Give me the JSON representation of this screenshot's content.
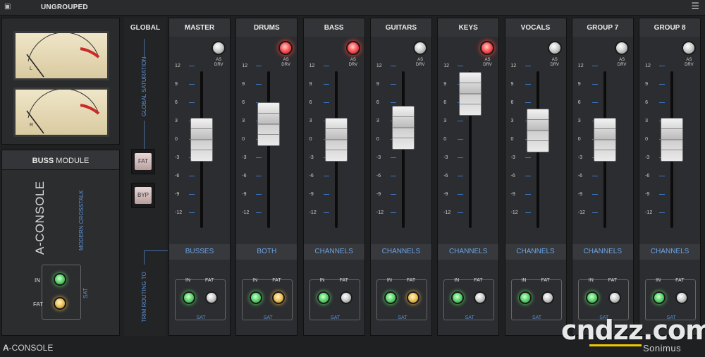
{
  "app": {
    "group_title": "UNGROUPED"
  },
  "left": {
    "vu_meters": [
      {
        "channel": "L",
        "scale": [
          "20",
          "10",
          "7",
          "5",
          "3",
          "2",
          "1",
          "0",
          "1",
          "2",
          "3"
        ]
      },
      {
        "channel": "R",
        "scale": [
          "20",
          "10",
          "7",
          "5",
          "3",
          "2",
          "1",
          "0",
          "1",
          "2",
          "3"
        ]
      }
    ],
    "buss_header_bold": "BUSS",
    "buss_header_rest": " MODULE",
    "brand_vertical": "A-CONSOLE",
    "brand_sub_vertical": "MODERN CROSSTALK",
    "in_label": "IN",
    "fat_label": "FAT",
    "sat_label": "SAT",
    "footer_brand_bold": "A",
    "footer_brand_rest": "-CONSOLE"
  },
  "global": {
    "label": "GLOBAL",
    "saturation_label": "GLOBAL SATURATION",
    "fat_button": "FAT",
    "byp_button": "BYP",
    "trim_label": "TRIM ROUTING TO"
  },
  "scale_ticks": [
    "12",
    "9",
    "6",
    "3",
    "0",
    "-3",
    "-6",
    "-9",
    "-12"
  ],
  "drive_label_1": "AS",
  "drive_label_2": "DRV",
  "in_label": "IN",
  "fat_label": "FAT",
  "sat_label": "SAT",
  "channels": [
    {
      "name": "MASTER",
      "route": "BUSSES",
      "drv": "off",
      "fat": "off",
      "fader_db": 0
    },
    {
      "name": "DRUMS",
      "route": "BOTH",
      "drv": "red",
      "fat": "amber",
      "fader_db": 2.5
    },
    {
      "name": "BASS",
      "route": "CHANNELS",
      "drv": "red",
      "fat": "off",
      "fader_db": 0
    },
    {
      "name": "GUITARS",
      "route": "CHANNELS",
      "drv": "off",
      "fat": "amber",
      "fader_db": 2
    },
    {
      "name": "KEYS",
      "route": "CHANNELS",
      "drv": "red",
      "fat": "off",
      "fader_db": 7.5
    },
    {
      "name": "VOCALS",
      "route": "CHANNELS",
      "drv": "off",
      "fat": "off",
      "fader_db": 1.5
    },
    {
      "name": "GROUP 7",
      "route": "CHANNELS",
      "drv": "off",
      "fat": "off",
      "fader_db": 0
    },
    {
      "name": "GROUP 8",
      "route": "CHANNELS",
      "drv": "off",
      "fat": "off",
      "fader_db": 0
    }
  ],
  "watermark": {
    "text": "cndzz.com",
    "brand": "Sonimus"
  }
}
